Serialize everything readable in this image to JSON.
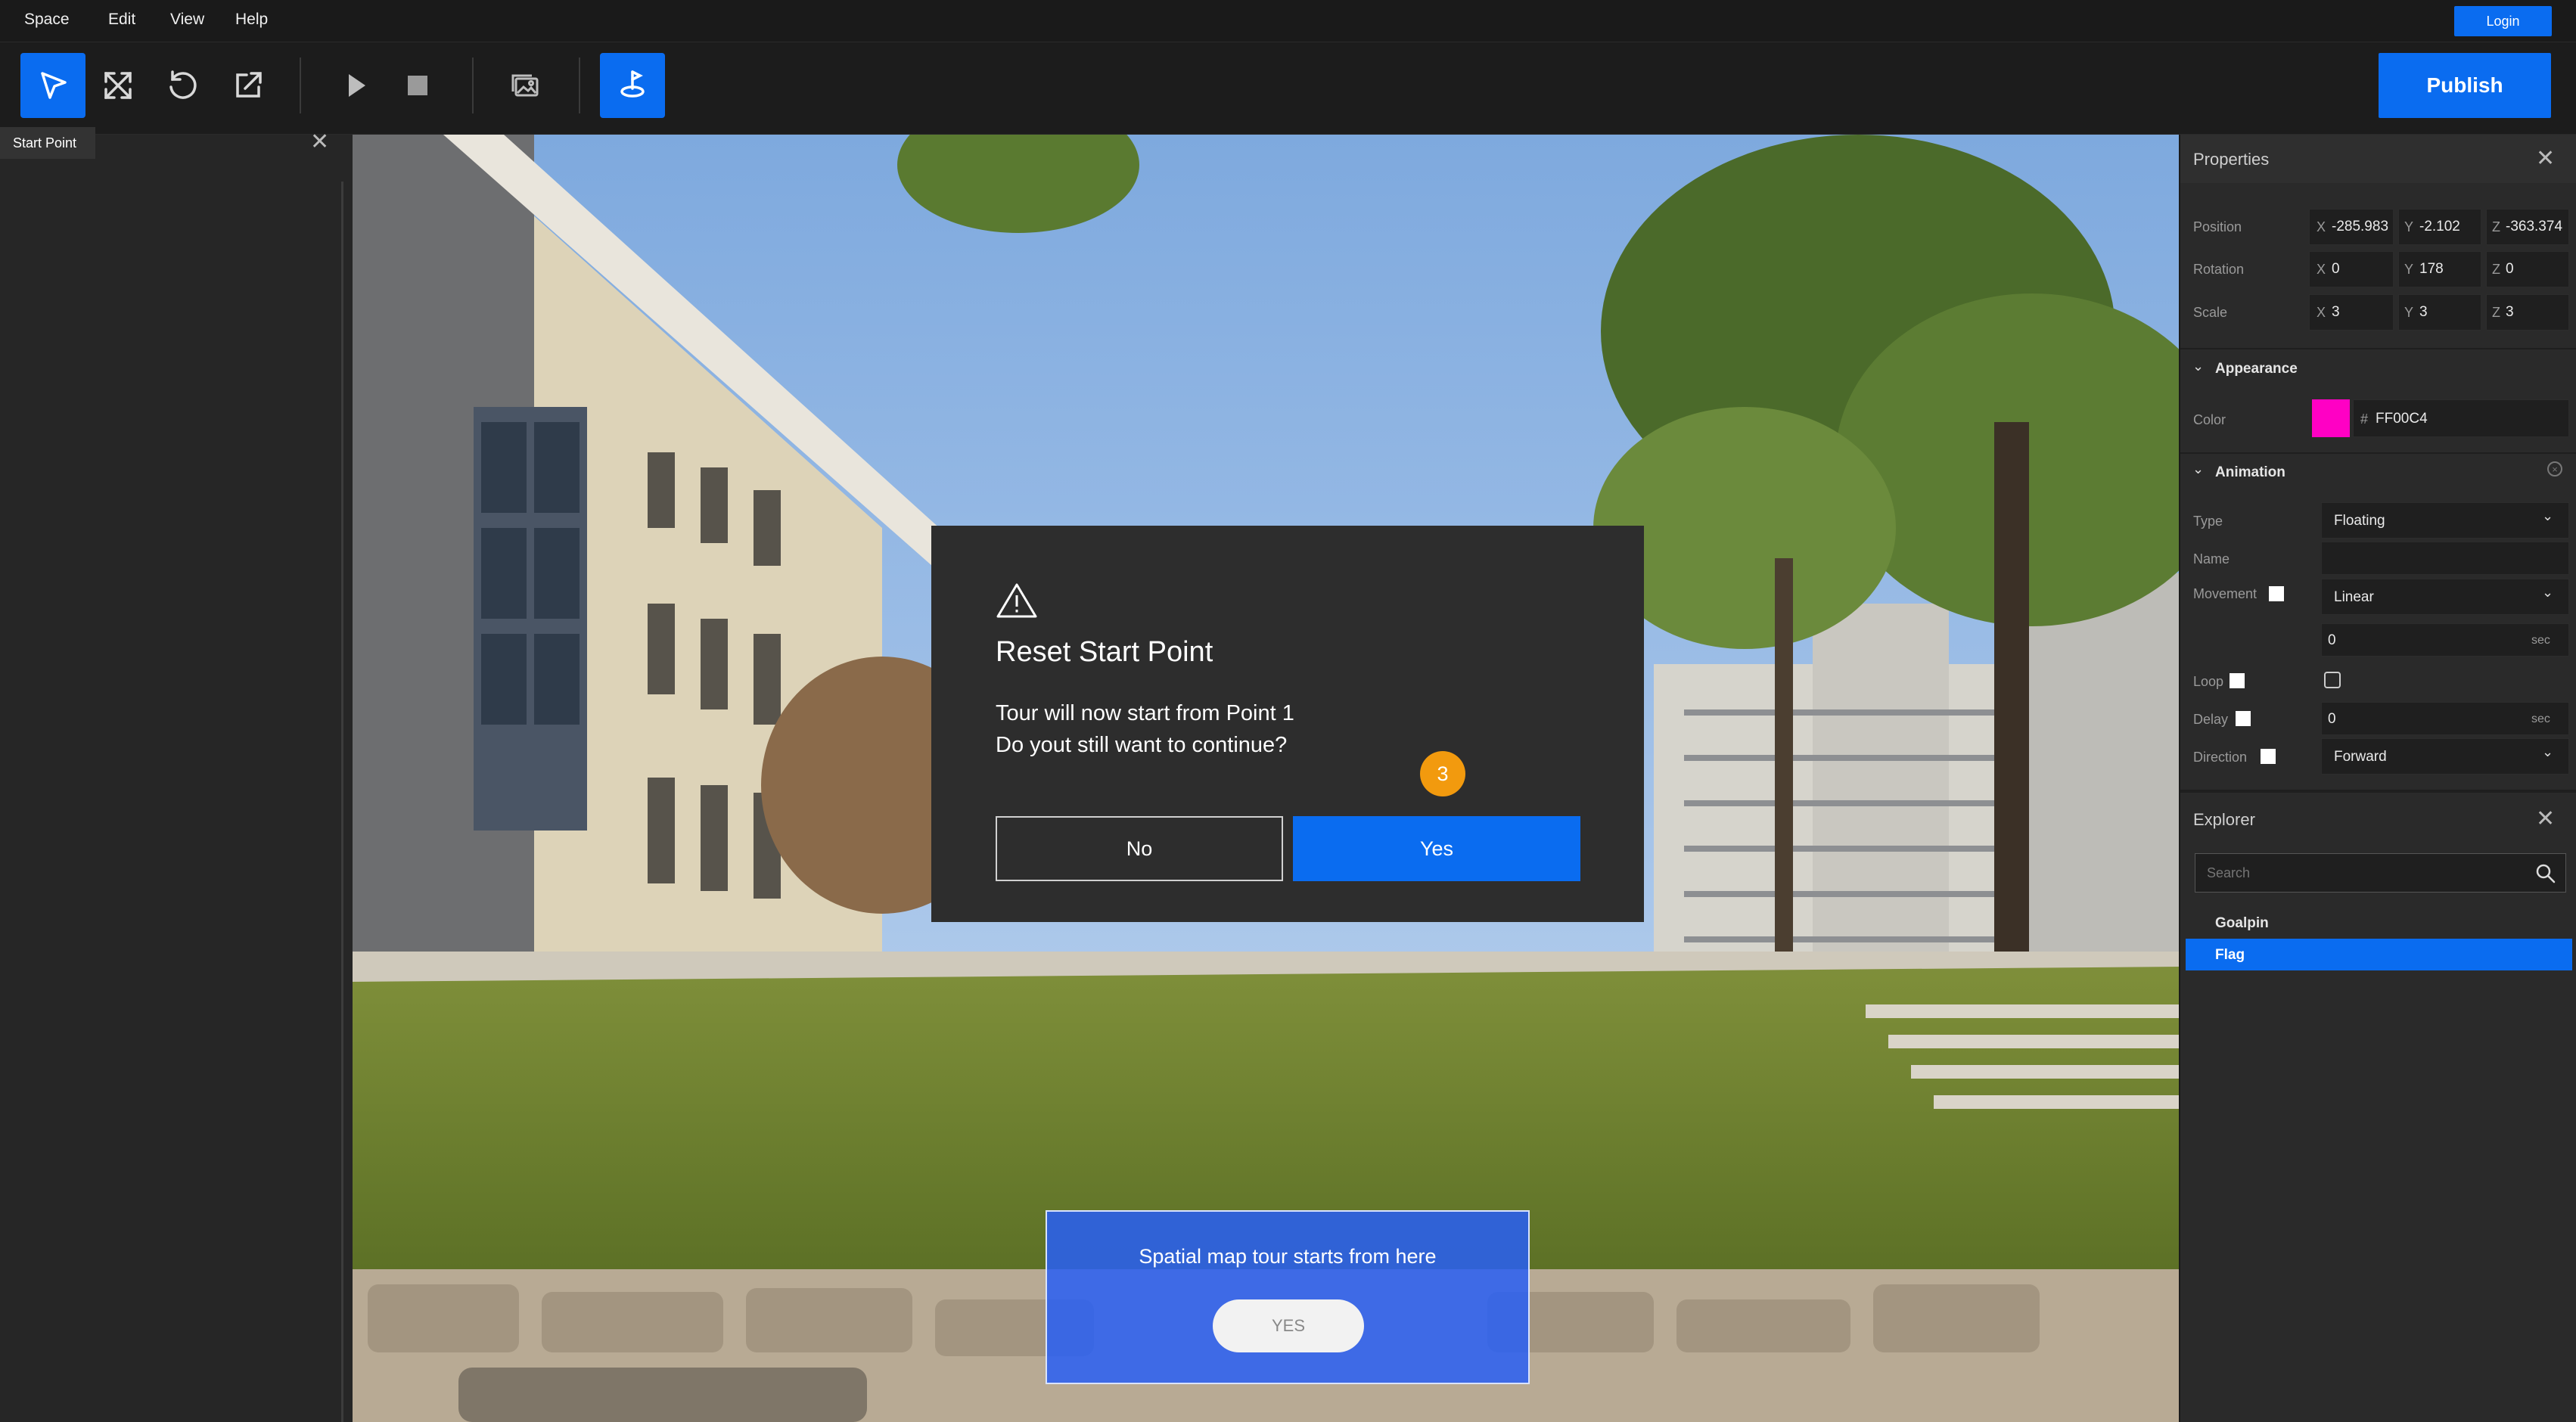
{
  "menu": [
    "Space",
    "Edit",
    "View",
    "Help"
  ],
  "login_label": "Login",
  "toolbar": {
    "tools": [
      "select-tool-icon",
      "scale-tool-icon",
      "rotate-tool-icon",
      "export-tool-icon",
      "play-icon",
      "stop-icon",
      "gallery-icon",
      "start-point-icon"
    ],
    "publish_label": "Publish"
  },
  "left_panel": {
    "tab_label": "Start Point"
  },
  "dialog": {
    "title": "Reset Start Point",
    "message_line1": "Tour will now start from Point 1",
    "message_line2": "Do yout still want to continue?",
    "no_label": "No",
    "yes_label": "Yes",
    "step_number": "3"
  },
  "start_point_card": {
    "text": "Spatial map tour starts from here",
    "button_label": "YES"
  },
  "properties": {
    "title": "Properties",
    "position": {
      "label": "Position",
      "x": "-285.983",
      "y": "-2.102",
      "z": "-363.374"
    },
    "rotation": {
      "label": "Rotation",
      "x": "0",
      "y": "178",
      "z": "0"
    },
    "scale": {
      "label": "Scale",
      "x": "3",
      "y": "3",
      "z": "3"
    },
    "axes": [
      "X",
      "Y",
      "Z"
    ],
    "appearance": {
      "title": "Appearance",
      "color_label": "Color",
      "hash": "#",
      "color_value": "FF00C4",
      "swatch": "#ff00c4"
    },
    "animation": {
      "title": "Animation",
      "type_label": "Type",
      "type_value": "Floating",
      "name_label": "Name",
      "movement_label": "Movement",
      "movement_value": "Linear",
      "duration_value": "0",
      "unit": "sec",
      "loop_label": "Loop",
      "delay_label": "Delay",
      "delay_value": "0",
      "direction_label": "Direction",
      "direction_value": "Forward"
    }
  },
  "explorer": {
    "title": "Explorer",
    "search_placeholder": "Search",
    "items": [
      "Goalpin",
      "Flag"
    ]
  },
  "colors": {
    "accent": "#0a6cf0",
    "badge": "#f29a0e"
  }
}
